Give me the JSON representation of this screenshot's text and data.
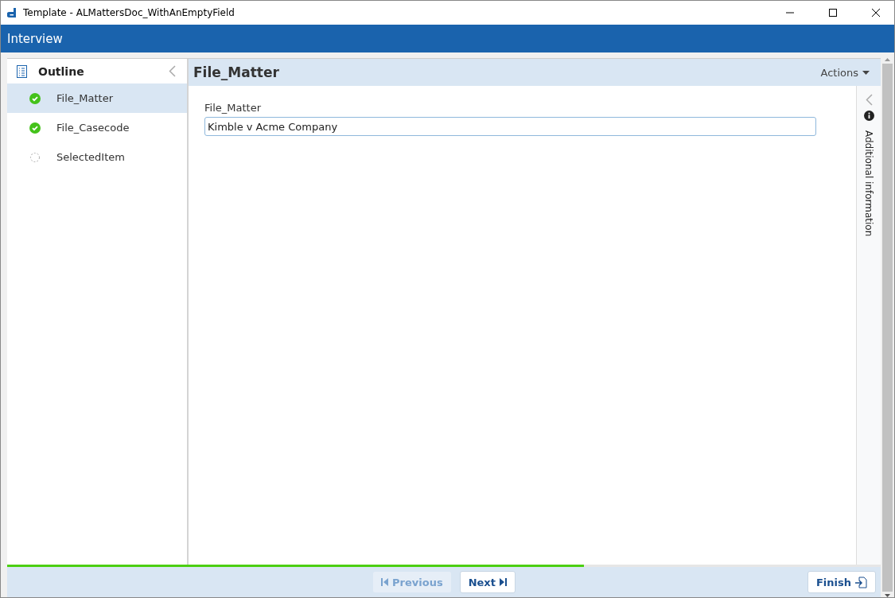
{
  "window": {
    "title": "Template - ALMattersDoc_WithAnEmptyField"
  },
  "header": {
    "title": "Interview"
  },
  "outline": {
    "title": "Outline",
    "items": [
      {
        "label": "File_Matter",
        "complete": true,
        "selected": true
      },
      {
        "label": "File_Casecode",
        "complete": true,
        "selected": false
      },
      {
        "label": "SelectedItem",
        "complete": false,
        "selected": false
      }
    ]
  },
  "page": {
    "title": "File_Matter",
    "actions": "Actions",
    "field": {
      "label": "File_Matter",
      "value": "Kimble v Acme Company"
    },
    "side_panel": "Additional information"
  },
  "progress": {
    "level": 0.66
  },
  "footer": {
    "previous": {
      "label": "Previous",
      "disabled": true
    },
    "next": {
      "label": "Next",
      "disabled": false
    },
    "finish": {
      "label": "Finish"
    }
  }
}
